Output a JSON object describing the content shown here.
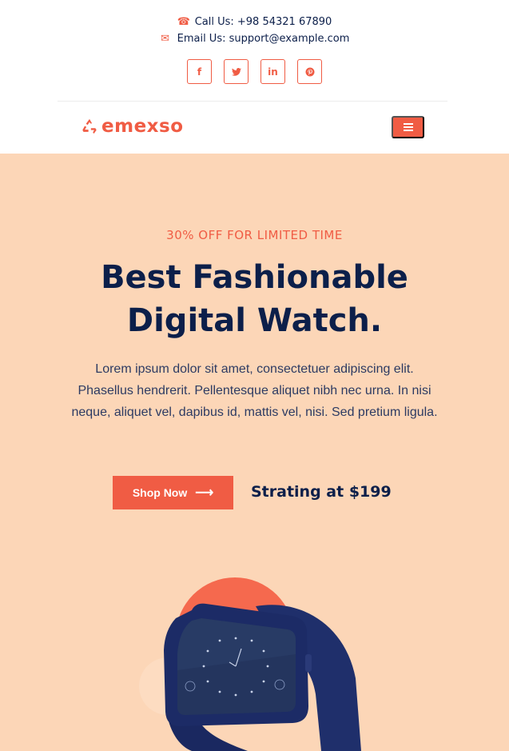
{
  "contact": {
    "phone": "Call Us: +98 54321 67890",
    "email": "Email Us: support@example.com",
    "phone_icon": "phone-icon",
    "email_icon": "envelope-icon"
  },
  "socials": [
    {
      "name": "facebook",
      "glyph": "f"
    },
    {
      "name": "twitter",
      "glyph": "t"
    },
    {
      "name": "linkedin",
      "glyph": "in"
    },
    {
      "name": "pinterest",
      "glyph": "P"
    }
  ],
  "brand": {
    "logo_text": "emexso",
    "accent_color": "#f05c44",
    "hero_bg": "#fcd6b7",
    "navy": "#0c1f4a"
  },
  "nav": {
    "menu_icon": "hamburger-icon"
  },
  "hero": {
    "offer": "30% OFF FOR LIMITED TIME",
    "title_line1": "Best Fashionable",
    "title_line2": "Digital Watch.",
    "description": "Lorem ipsum dolor sit amet, consectetuer adipiscing elit. Phasellus hendrerit. Pellentesque aliquet nibh nec urna. In nisi neque, aliquet vel, dapibus id, mattis vel, nisi. Sed pretium ligula.",
    "cta_label": "Shop Now",
    "price_text": "Strating at $199"
  }
}
